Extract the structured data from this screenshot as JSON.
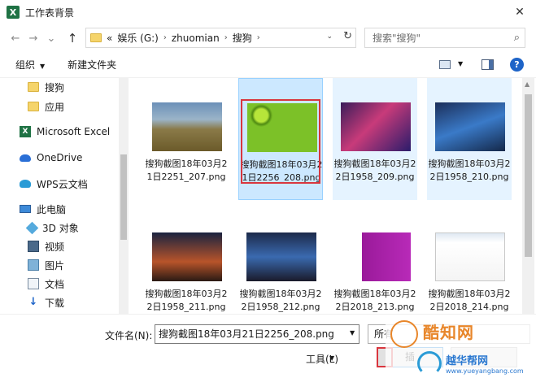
{
  "window": {
    "title": "工作表背景",
    "app_icon_letter": "X",
    "close_glyph": "✕"
  },
  "address": {
    "back_glyph": "←",
    "forward_glyph": "→",
    "history_glyph": "⌄",
    "up_glyph": "↑",
    "overflow": "«",
    "crumbs": [
      "娱乐 (G:)",
      "zhuomian",
      "搜狗"
    ],
    "sep_glyph": "›",
    "refresh_glyph": "↻",
    "search_placeholder": "搜索\"搜狗\"",
    "search_glyph": "⌕"
  },
  "toolbar": {
    "organize_label": "组织",
    "caret_glyph": "▼",
    "new_folder_label": "新建文件夹",
    "help_glyph": "?"
  },
  "nav": {
    "items": [
      {
        "label": "搜狗",
        "icon": "folder-icon"
      },
      {
        "label": "应用",
        "icon": "folder-icon"
      },
      {
        "label": "Microsoft Excel",
        "icon": "excel-icon"
      },
      {
        "label": "OneDrive",
        "icon": "cloud-icon"
      },
      {
        "label": "WPS云文档",
        "icon": "wps-cloud-icon"
      },
      {
        "label": "此电脑",
        "icon": "computer-icon"
      },
      {
        "label": "3D 对象",
        "icon": "3d-objects-icon"
      },
      {
        "label": "视频",
        "icon": "video-icon"
      },
      {
        "label": "图片",
        "icon": "pictures-icon"
      },
      {
        "label": "文档",
        "icon": "documents-icon"
      },
      {
        "label": "下载",
        "icon": "download-icon"
      }
    ]
  },
  "files": [
    {
      "label": "搜狗截图18年03月21日2251_207.png",
      "thumb": "landscape-thumbnail"
    },
    {
      "label": "搜狗截图18年03月21日2256_208.png",
      "thumb": "kiwi-thumbnail",
      "selected": true
    },
    {
      "label": "搜狗截图18年03月22日1958_209.png",
      "thumb": "game-thumbnail"
    },
    {
      "label": "搜狗截图18年03月22日1958_210.png",
      "thumb": "game-thumbnail"
    },
    {
      "label": "搜狗截图18年03月22日1958_211.png",
      "thumb": "game-thumbnail"
    },
    {
      "label": "搜狗截图18年03月22日1958_212.png",
      "thumb": "game-thumbnail"
    },
    {
      "label": "搜狗截图18年03月22日2018_213.png",
      "thumb": "screenshot-thumbnail"
    },
    {
      "label": "搜狗截图18年03月22日2018_214.png",
      "thumb": "screenshot-thumbnail"
    }
  ],
  "footer": {
    "filename_label": "文件名(N):",
    "filename_value": "搜狗截图18年03月21日2256_208.png",
    "filter_value": "所有",
    "tools_label": "工具(L)",
    "insert_label": "插"
  },
  "watermark": {
    "brand": "酷知网",
    "site_name": "越华帮网",
    "site_url": "www.yueyangbang.com"
  }
}
